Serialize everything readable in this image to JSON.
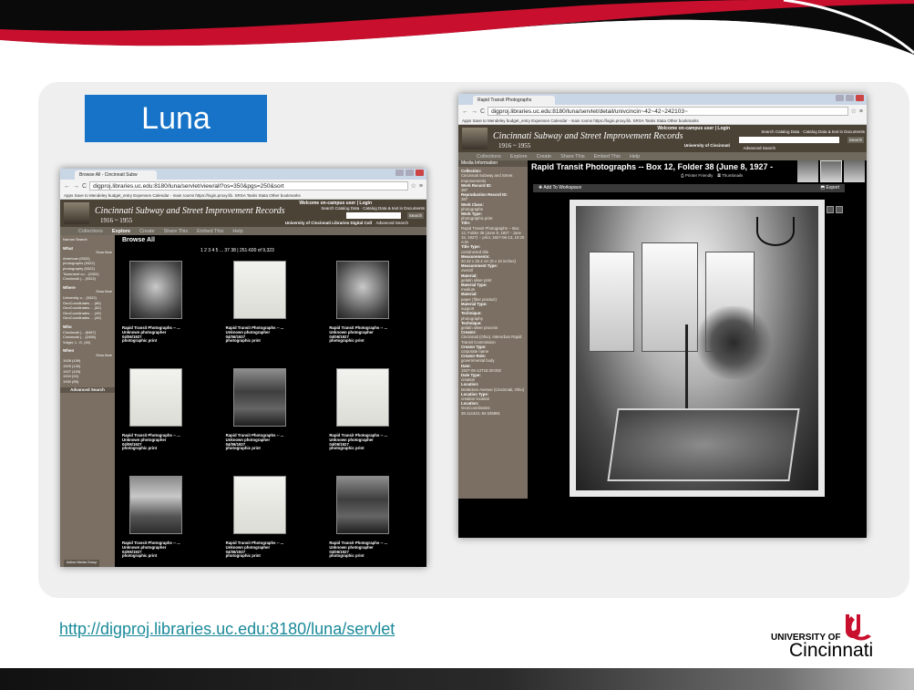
{
  "slide": {
    "title": "Luna",
    "link_text": "http://digproj.libraries.uc.edu:8180/luna/servlet",
    "logo": {
      "line1": "UNIVERSITY OF",
      "line2": "Cincinnati"
    },
    "colors": {
      "accent_blue": "#1673c8",
      "banner_red": "#c8102e",
      "link": "#1a8a9a",
      "panel_bg": "#efefef"
    }
  },
  "browse_screenshot": {
    "tab_title": "Browse All - Cincinnati Subw",
    "url": "digproj.libraries.uc.edu:8180/luna/servlet/view/all?os=350&pgs=250&sort",
    "bookmarks": "Apps   Save to Mendeley   budget_entry   Expenses   Calendar - main rooms   https://login.proxy.lib.   SRSA Tasks   Stata   Other bookmarks",
    "header": {
      "title": "Cincinnati Subway and Street Improvement Records",
      "years": "1916 ~ 1955",
      "welcome": "Welcome on-campus user | Login",
      "radio1": "Search Catalog Data",
      "radio2": "Catalog Data & text in Documents",
      "search_btn": "Search",
      "university": "University of Cincinnati Libraries Digital Coll",
      "advanced": "Advanced Search"
    },
    "menu": [
      "Collections",
      "Explore",
      "Create",
      "Share This",
      "Embed This",
      "Help"
    ],
    "sidebar": {
      "narrow": "Narrow Search",
      "what": "What",
      "show_more": "Show More",
      "what_items": [
        "American (9322)",
        "photographs (9322)",
        "photography (9322)",
        "Townmeet co... (9322)",
        "Cincinnati (... (9322)"
      ],
      "where": "Where",
      "where_items": [
        "University o... (9322)",
        "GeoCoordinates ... (86)",
        "GeoCoordinates ... (52)",
        "GeoCoordinates ... (49)",
        "GeoCoordinates ... (49)"
      ],
      "who": "Who",
      "who_items": [
        "Cincinnati (... (8467)",
        "Cincinnati (... (2456)",
        "Volger, L. G. (40)"
      ],
      "when": "When",
      "when_items": [
        "1928 (159)",
        "1929 (130)",
        "1927 (103)",
        "1924 (92)",
        "1930 (85)"
      ],
      "advanced": "Advanced Search",
      "media_group": "Active Media Group"
    },
    "browse_all": "Browse All",
    "pager": "1 2 3 4 5 ... 37 38  |  251-600 of 9,323",
    "items": [
      {
        "title": "Rapid Transit Photographs -- ...",
        "photographer": "Unknown photographer",
        "date": "04/06/1927",
        "type": "photographic print",
        "kind": "photo"
      },
      {
        "title": "Rapid Transit Photographs -- ...",
        "photographer": "Unknown photographer",
        "date": "04/06/1927",
        "type": "photographic print",
        "kind": "paper"
      },
      {
        "title": "Rapid Transit Photographs -- ...",
        "photographer": "Unknown photographer",
        "date": "04/06/1927",
        "type": "photographic print",
        "kind": "photo"
      },
      {
        "title": "Rapid Transit Photographs -- ...",
        "photographer": "Unknown photographer",
        "date": "04/06/1927",
        "type": "photographic print",
        "kind": "paper"
      },
      {
        "title": "Rapid Transit Photographs -- ...",
        "photographer": "Unknown photographer",
        "date": "04/06/1927",
        "type": "photographic print",
        "kind": "building"
      },
      {
        "title": "Rapid Transit Photographs -- ...",
        "photographer": "Unknown photographer",
        "date": "04/06/1927",
        "type": "photographic print",
        "kind": "paper"
      },
      {
        "title": "Rapid Transit Photographs -- ...",
        "photographer": "Unknown photographer",
        "date": "04/06/1927",
        "type": "photographic print",
        "kind": "rubble"
      },
      {
        "title": "Rapid Transit Photographs -- ...",
        "photographer": "Unknown photographer",
        "date": "04/06/1927",
        "type": "photographic print",
        "kind": "paper"
      },
      {
        "title": "Rapid Transit Photographs -- ...",
        "photographer": "Unknown photographer",
        "date": "04/06/1927",
        "type": "photographic print",
        "kind": "building"
      }
    ]
  },
  "detail_screenshot": {
    "tab_title": "Rapid Transit Photographs",
    "url": "digproj.libraries.uc.edu:8180/luna/servlet/detail/univcincin~42~42~242103~",
    "bookmarks": "Apps   Save to Mendeley   budget_entry   Expenses   Calendar - main rooms   https://login.proxy.lib.   SRSA Tasks   Stata   Other bookmarks",
    "header": {
      "title": "Cincinnati Subway and Street Improvement Records",
      "years": "1916 ~ 1955",
      "welcome": "Welcome on-campus user | Login",
      "radio1": "Search Catalog Data",
      "radio2": "Catalog Data & text in Documents",
      "search_btn": "Search",
      "university": "University of Cincinnati",
      "advanced": "Advanced Search"
    },
    "menu": [
      "Collections",
      "Explore",
      "Create",
      "Share This",
      "Embed This",
      "Help"
    ],
    "media_info": "Media Information",
    "title": "Rapid Transit Photographs -- Box 12, Folder 38 (June 8, 1927 -",
    "printer_friendly": "Printer Friendly",
    "thumbnails": "Thumbnails",
    "add_to_workspace": "Add To Workspace",
    "export": "Export",
    "fields": [
      {
        "label": "Collection:",
        "value": "Cincinnati Subway and Street Improvements"
      },
      {
        "label": "Work Record ID:",
        "value": "387"
      },
      {
        "label": "Reproduction Record ID:",
        "value": "387"
      },
      {
        "label": "Work Class:",
        "value": "photographs"
      },
      {
        "label": "Work Type:",
        "value": "photographic print"
      },
      {
        "label": "Title:",
        "value": "Rapid Transit Photographs -- Box 12, Folder 38 (June 8, 1927 - June 15, 1927) -- print, 1927-06-13, 10:20 A.M."
      },
      {
        "label": "Title Type:",
        "value": "constructed title"
      },
      {
        "label": "Measurements:",
        "value": "20.32 x 25.4 cm (8 x 10 inches)"
      },
      {
        "label": "Measurement Type:",
        "value": "overall"
      },
      {
        "label": "Material:",
        "value": "gelatin silver print"
      },
      {
        "label": "Material Type:",
        "value": "medium"
      },
      {
        "label": "Material:",
        "value": "paper (fiber product)"
      },
      {
        "label": "Material Type:",
        "value": "support"
      },
      {
        "label": "Technique:",
        "value": "photography"
      },
      {
        "label": "Technique:",
        "value": "gelatin silver process"
      },
      {
        "label": "Creator:",
        "value": "Cincinnati (Ohio). Interurban Rapid Transit Commission"
      },
      {
        "label": "Creator Type:",
        "value": "corporate name"
      },
      {
        "label": "Creator Role:",
        "value": "governmental body"
      },
      {
        "label": "Date:",
        "value": "1927-06-13T15:20:00Z"
      },
      {
        "label": "Date Type:",
        "value": "creation"
      },
      {
        "label": "Location:",
        "value": "McMicken Avenue (Cincinnati, Ohio)"
      },
      {
        "label": "Location Type:",
        "value": "creation location"
      },
      {
        "label": "Location:",
        "value": "GeoCoordinates: 39.114424,-84.535891"
      }
    ]
  }
}
